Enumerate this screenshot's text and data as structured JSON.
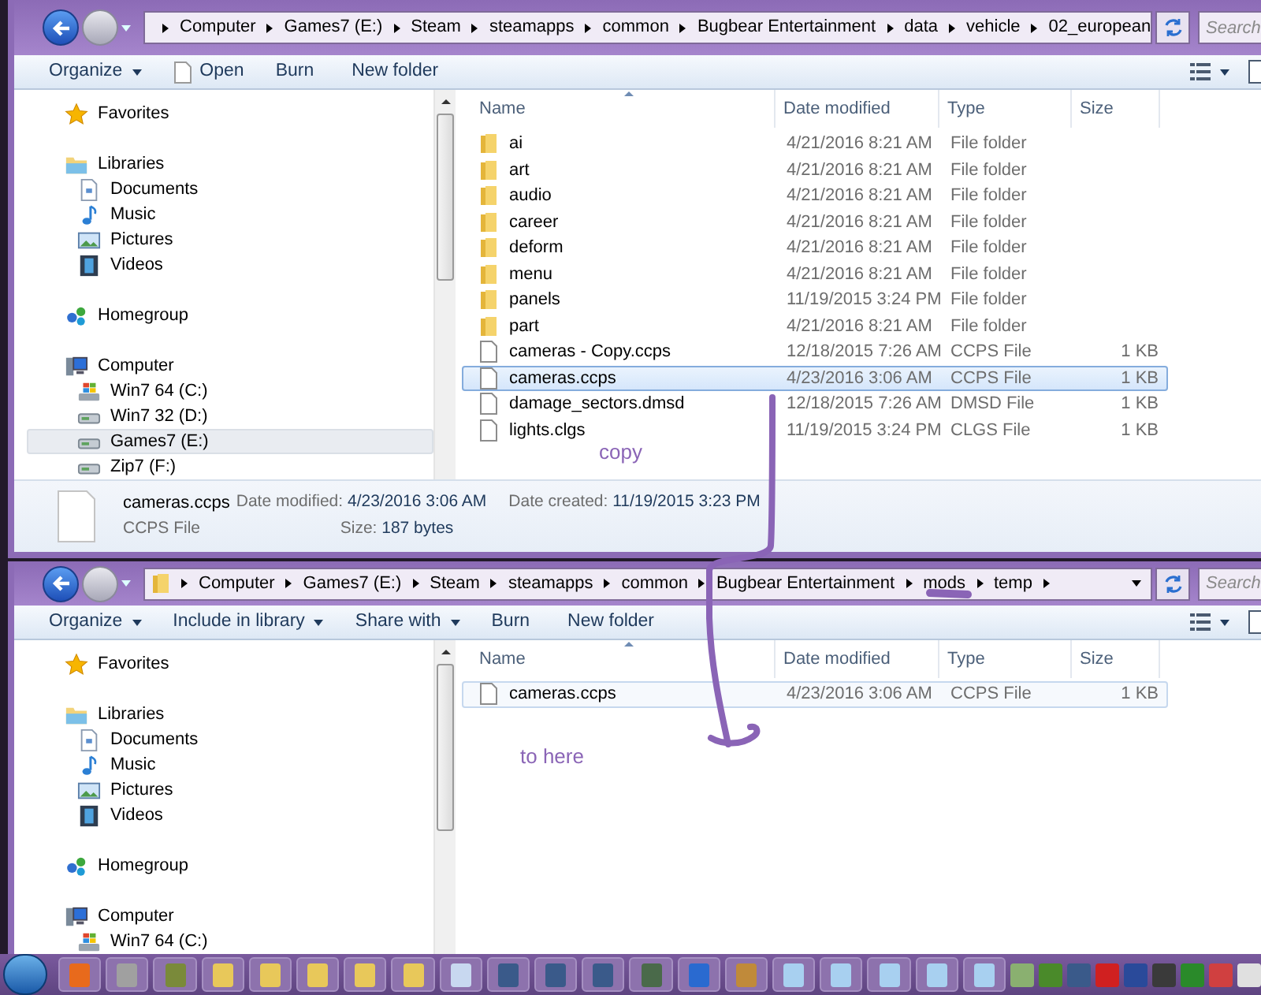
{
  "windows": [
    {
      "breadcrumb": [
        "Computer",
        "Games7 (E:)",
        "Steam",
        "steamapps",
        "common",
        "Bugbear Entertainment",
        "data",
        "vehicle",
        "02_european"
      ],
      "search": {
        "placeholder": "Search"
      },
      "toolbar": [
        {
          "label": "Organize",
          "kind": "menu"
        },
        {
          "label": "Open",
          "kind": "open"
        },
        {
          "label": "Burn",
          "kind": "button"
        },
        {
          "label": "New folder",
          "kind": "button"
        }
      ],
      "nav": [
        {
          "label": "Favorites",
          "kind": "star",
          "selected": false
        },
        {
          "label": "Libraries",
          "kind": "library",
          "selected": false,
          "children": [
            {
              "label": "Documents",
              "kind": "document",
              "selected": false
            },
            {
              "label": "Music",
              "kind": "music",
              "selected": false
            },
            {
              "label": "Pictures",
              "kind": "picture",
              "selected": false
            },
            {
              "label": "Videos",
              "kind": "video",
              "selected": false
            }
          ]
        },
        {
          "label": "Homegroup",
          "kind": "homegroup",
          "selected": false
        },
        {
          "label": "Computer",
          "kind": "computer",
          "selected": false,
          "children": [
            {
              "label": "Win7 64 (C:)",
              "kind": "system-drive",
              "selected": false
            },
            {
              "label": "Win7 32 (D:)",
              "kind": "drive",
              "selected": false
            },
            {
              "label": "Games7 (E:)",
              "kind": "drive",
              "selected": true
            },
            {
              "label": "Zip7 (F:)",
              "kind": "drive",
              "selected": false
            }
          ]
        }
      ],
      "columns": [
        "Name",
        "Date modified",
        "Type",
        "Size"
      ],
      "rows": [
        {
          "name": "ai",
          "date": "4/21/2016 8:21 AM",
          "type": "File folder",
          "kind": "folder",
          "selected": false
        },
        {
          "name": "art",
          "date": "4/21/2016 8:21 AM",
          "type": "File folder",
          "kind": "folder",
          "selected": false
        },
        {
          "name": "audio",
          "date": "4/21/2016 8:21 AM",
          "type": "File folder",
          "kind": "folder",
          "selected": false
        },
        {
          "name": "career",
          "date": "4/21/2016 8:21 AM",
          "type": "File folder",
          "kind": "folder",
          "selected": false
        },
        {
          "name": "deform",
          "date": "4/21/2016 8:21 AM",
          "type": "File folder",
          "kind": "folder",
          "selected": false
        },
        {
          "name": "menu",
          "date": "4/21/2016 8:21 AM",
          "type": "File folder",
          "kind": "folder",
          "selected": false
        },
        {
          "name": "panels",
          "date": "11/19/2015 3:24 PM",
          "type": "File folder",
          "kind": "folder",
          "selected": false
        },
        {
          "name": "part",
          "date": "4/21/2016 8:21 AM",
          "type": "File folder",
          "kind": "folder",
          "selected": false
        },
        {
          "name": "cameras - Copy.ccps",
          "date": "12/18/2015 7:26 AM",
          "type": "CCPS File",
          "size": "1 KB",
          "kind": "file",
          "selected": false
        },
        {
          "name": "cameras.ccps",
          "date": "4/23/2016 3:06 AM",
          "type": "CCPS File",
          "size": "1 KB",
          "kind": "file",
          "selected": true
        },
        {
          "name": "damage_sectors.dmsd",
          "date": "12/18/2015 7:26 AM",
          "type": "DMSD File",
          "size": "1 KB",
          "kind": "file",
          "selected": false
        },
        {
          "name": "lights.clgs",
          "date": "11/19/2015 3:24 PM",
          "type": "CLGS File",
          "size": "1 KB",
          "kind": "file",
          "selected": false
        }
      ],
      "details": {
        "name": "cameras.ccps",
        "type": "CCPS File",
        "fields": [
          {
            "label": "Date modified:",
            "value": "4/23/2016 3:06 AM"
          },
          {
            "label": "Size:",
            "value": "187 bytes"
          },
          {
            "label": "Date created:",
            "value": "11/19/2015 3:23 PM"
          }
        ]
      }
    },
    {
      "breadcrumb": [
        "Computer",
        "Games7 (E:)",
        "Steam",
        "steamapps",
        "common",
        "Bugbear Entertainment",
        "mods",
        "temp"
      ],
      "search": {
        "placeholder": "Search"
      },
      "toolbar": [
        {
          "label": "Organize",
          "kind": "menu"
        },
        {
          "label": "Include in library",
          "kind": "menu"
        },
        {
          "label": "Share with",
          "kind": "menu"
        },
        {
          "label": "Burn",
          "kind": "button"
        },
        {
          "label": "New folder",
          "kind": "button"
        }
      ],
      "nav": [
        {
          "label": "Favorites",
          "kind": "star",
          "selected": false
        },
        {
          "label": "Libraries",
          "kind": "library",
          "selected": false,
          "children": [
            {
              "label": "Documents",
              "kind": "document",
              "selected": false
            },
            {
              "label": "Music",
              "kind": "music",
              "selected": false
            },
            {
              "label": "Pictures",
              "kind": "picture",
              "selected": false
            },
            {
              "label": "Videos",
              "kind": "video",
              "selected": false
            }
          ]
        },
        {
          "label": "Homegroup",
          "kind": "homegroup",
          "selected": false
        },
        {
          "label": "Computer",
          "kind": "computer",
          "selected": false,
          "children": [
            {
              "label": "Win7 64 (C:)",
              "kind": "system-drive",
              "selected": false
            }
          ]
        }
      ],
      "columns": [
        "Name",
        "Date modified",
        "Type",
        "Size"
      ],
      "rows": [
        {
          "name": "cameras.ccps",
          "date": "4/23/2016 3:06 AM",
          "type": "CCPS File",
          "size": "1 KB",
          "kind": "file",
          "selected": true
        }
      ]
    }
  ],
  "annotations": [
    {
      "text": "copy"
    },
    {
      "text": "to here"
    }
  ]
}
